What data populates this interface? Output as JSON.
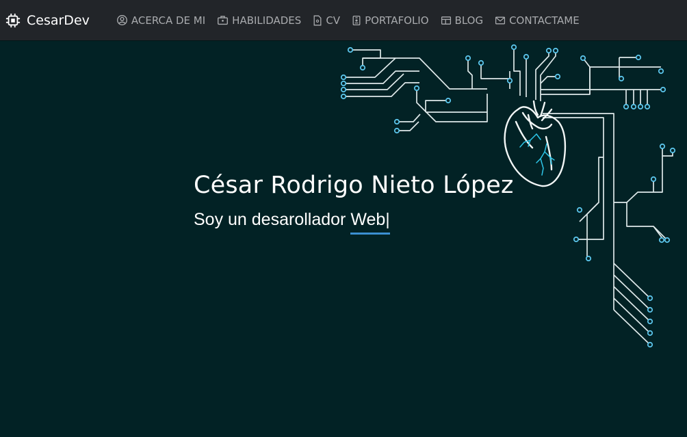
{
  "brand": {
    "name": "CesarDev",
    "icon": "chip-icon"
  },
  "nav": {
    "items": [
      {
        "label": "ACERCA DE MI",
        "icon": "user-circle-icon"
      },
      {
        "label": "HABILIDADES",
        "icon": "briefcase-icon"
      },
      {
        "label": "CV",
        "icon": "document-icon"
      },
      {
        "label": "PORTAFOLIO",
        "icon": "id-badge-icon"
      },
      {
        "label": "BLOG",
        "icon": "newspaper-icon"
      },
      {
        "label": "CONTACTAME",
        "icon": "envelope-icon"
      }
    ]
  },
  "hero": {
    "name": "César Rodrigo Nieto López",
    "subtitle_prefix": "Soy un desarollador ",
    "typed_word": "Web",
    "cursor": "|",
    "illustration": "circuit-heart-illustration"
  },
  "colors": {
    "background": "#022225",
    "navbar": "#222529",
    "nav_text": "#a9abae",
    "accent_underline": "#3b8fd1",
    "circuit_node": "#5bc4ea",
    "vein": "#2ec6e8"
  }
}
